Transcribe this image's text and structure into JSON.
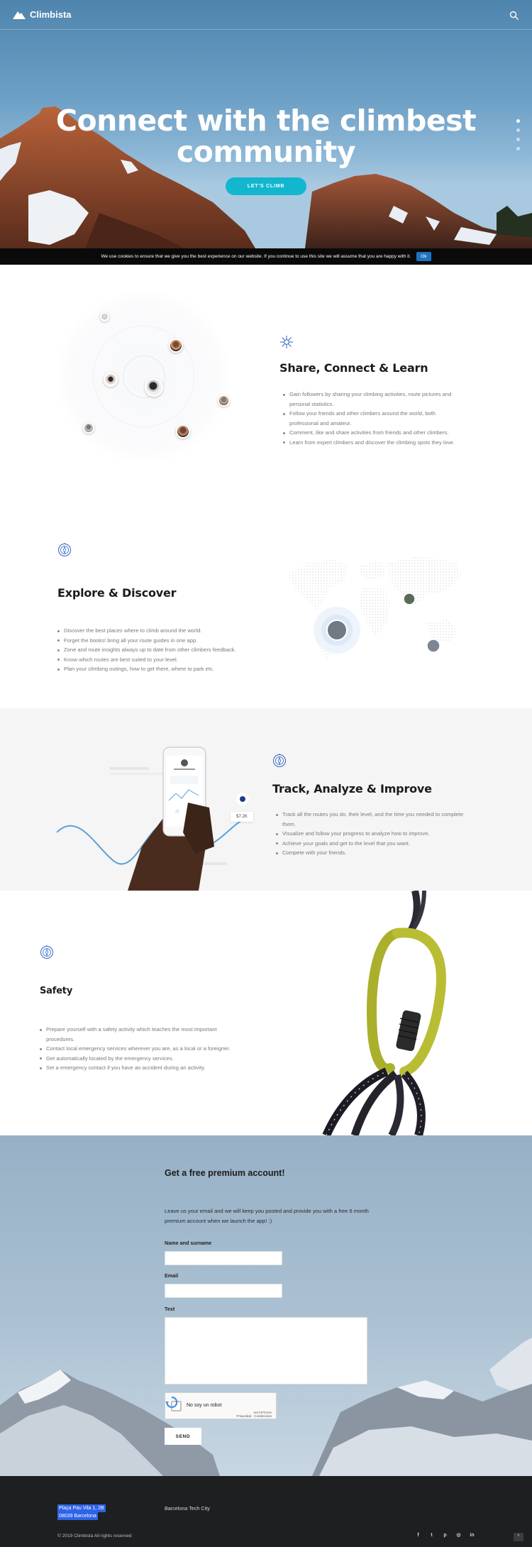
{
  "brand": {
    "name": "Climbista",
    "accent": "#12b6cf"
  },
  "hero": {
    "title": "Connect with the climbest community",
    "cta_label": "LET'S CLIMB"
  },
  "cookie": {
    "text": "We use cookies to ensure that we give you the best experience on our website. If you continue to use this site we will assume that you are happy with it.",
    "ok_label": "Ok"
  },
  "features": [
    {
      "title": "Share, Connect & Learn",
      "icon": "network-icon",
      "items": [
        "Gain followers by sharing your climbing activities, route pictures and personal statistics.",
        "Follow your friends and other climbers around the world, both professional and amateur.",
        "Comment, like and share activities from friends and other climbers.",
        "Learn from expert climbers and discover the climbing spots they love."
      ]
    },
    {
      "title": "Explore & Discover",
      "icon": "compass-icon",
      "items": [
        "Discover the best places where to climb around the world.",
        "Forget the books! bring all your route guides in one app.",
        "Zone and route insights always up to date from other climbers feedback.",
        "Know which routes are best suited to your level.",
        "Plan your climbing outings, how to get there, where to park etc."
      ]
    },
    {
      "title": "Track, Analyze & Improve",
      "icon": "compass-icon",
      "items": [
        "Track all the routes you do, their level, and the time you needed to complete them.",
        "Visualize and follow your progress to analyze how to improve.",
        "Achieve your goals and get to the level that you want.",
        "Compete with your friends."
      ],
      "phone_badge": "$7.2K"
    },
    {
      "title": "Safety",
      "icon": "compass-icon",
      "items": [
        "Prepare yourself with a safety activity which teaches the most important procedures.",
        "Contact local emergency services wherever you are, as a local or a foreigner.",
        "Get automatically located by the emergency services.",
        "Set a emergency contact if you have an accident during an activity."
      ]
    }
  ],
  "signup": {
    "title": "Get a free premium account!",
    "text": "Leave us your email and we will keep you posted and provide you with a free 6 month premium account when we launch the app! :)",
    "name_label": "Name and surname",
    "email_label": "Email",
    "text_label": "Text",
    "captcha_label": "No soy un robot",
    "captcha_brand": "reCAPTCHA",
    "captcha_links": "Privacidad - Condiciones",
    "send_label": "SEND"
  },
  "footer": {
    "address_line1": "Plaça Pau Vila 1, 2B",
    "address_line2": "08039 Barcelona",
    "city": "Barcelona Tech City",
    "copyright": "© 2019 Climbista All rights reserved",
    "social": [
      "facebook-icon",
      "twitter-icon",
      "pinterest-icon",
      "instagram-icon",
      "linkedin-icon"
    ],
    "back_to_top": "^"
  }
}
